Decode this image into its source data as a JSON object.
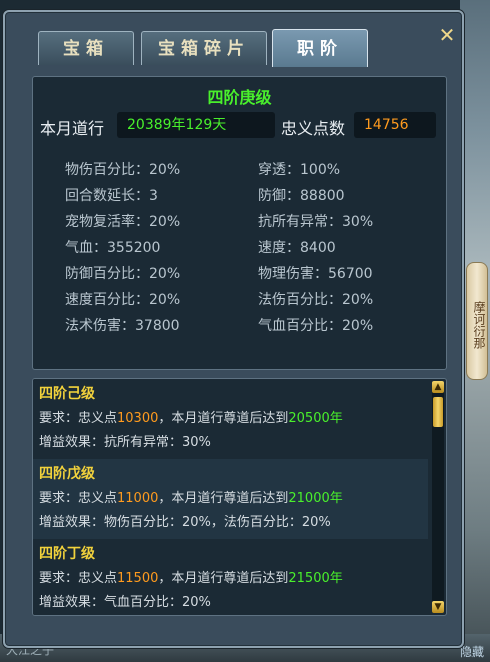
{
  "background": {
    "side_scroll_text": "摩诃衍那",
    "bottom_left_text": "大江之子",
    "bottom_right_text": "隐藏"
  },
  "close_icon": "close-x-icon",
  "tabs": [
    {
      "label": "宝箱",
      "active": false
    },
    {
      "label": "宝箱碎片",
      "active": false
    },
    {
      "label": "职阶",
      "active": true
    }
  ],
  "rank": {
    "title": "四阶庚级",
    "monthly_label": "本月道行",
    "monthly_value": "20389年129天",
    "loyalty_label": "忠义点数",
    "loyalty_value": "14756"
  },
  "stats_left": [
    "物伤百分比：20%",
    "回合数延长：3",
    "宠物复活率：20%",
    "气血：355200",
    "防御百分比：20%",
    "速度百分比：20%",
    "法术伤害：37800"
  ],
  "stats_right": [
    "穿透：100%",
    "防御：88800",
    "抗所有异常：30%",
    "速度：8400",
    "物理伤害：56700",
    "法伤百分比：20%",
    "气血百分比：20%"
  ],
  "levels": [
    {
      "name": "四阶己级",
      "req_prefix": "要求：忠义点",
      "req_points": "10300",
      "req_middle": "，本月道行尊道后达到",
      "req_years": "20500年",
      "effect": "增益效果：抗所有异常：30%"
    },
    {
      "name": "四阶戊级",
      "req_prefix": "要求：忠义点",
      "req_points": "11000",
      "req_middle": "，本月道行尊道后达到",
      "req_years": "21000年",
      "effect": "增益效果：物伤百分比：20%，法伤百分比：20%"
    },
    {
      "name": "四阶丁级",
      "req_prefix": "要求：忠义点",
      "req_points": "11500",
      "req_middle": "，本月道行尊道后达到",
      "req_years": "21500年",
      "effect": "增益效果：气血百分比：20%"
    }
  ],
  "scrollbar": {
    "up_icon": "arrow-up-icon",
    "down_icon": "arrow-down-icon"
  }
}
